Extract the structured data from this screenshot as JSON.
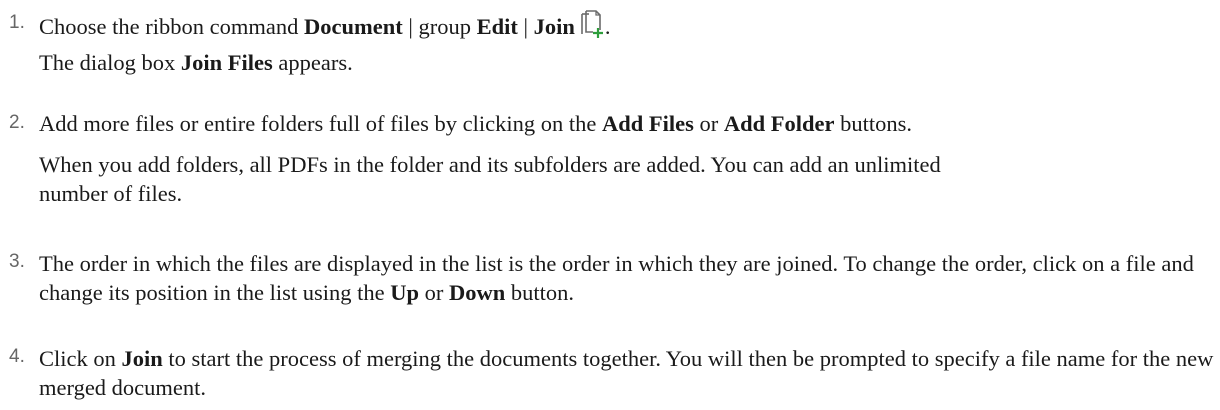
{
  "steps": [
    {
      "number": "1.",
      "lines": [
        {
          "t1": "Choose the ribbon command ",
          "b1": "Document",
          "t2": " | group ",
          "b2": "Edit",
          "t3": " | ",
          "b3": "Join",
          "t4": "."
        },
        {
          "t1": "The dialog box ",
          "b1": "Join Files",
          "t2": " appears."
        }
      ],
      "icon": "join-files-icon"
    },
    {
      "number": "2.",
      "lines": [
        {
          "t1": "Add more files or entire folders full of files by clicking on the ",
          "b1": "Add Files",
          "t2": " or ",
          "b2": "Add Folder",
          "t3": " buttons."
        },
        {
          "t1": "When you add folders, all PDFs in the folder and its subfolders are added. You can add an unlimited number of files."
        }
      ]
    },
    {
      "number": "3.",
      "lines": [
        {
          "t1": "The order in which the files are displayed in the list is the order in which they are joined. To change the order, click on a file and change its position in the list using the ",
          "b1": "Up",
          "t2": " or ",
          "b2": "Down",
          "t3": " button."
        }
      ]
    },
    {
      "number": "4.",
      "lines": [
        {
          "t1": "Click on ",
          "b1": "Join",
          "t2": " to start the process of merging the documents together. You will then be prompted to specify a file name for the new merged document."
        }
      ]
    }
  ],
  "colors": {
    "icon_plus": "#2e9e3c",
    "icon_outline": "#6b6b6b",
    "number_text": "#666666"
  }
}
